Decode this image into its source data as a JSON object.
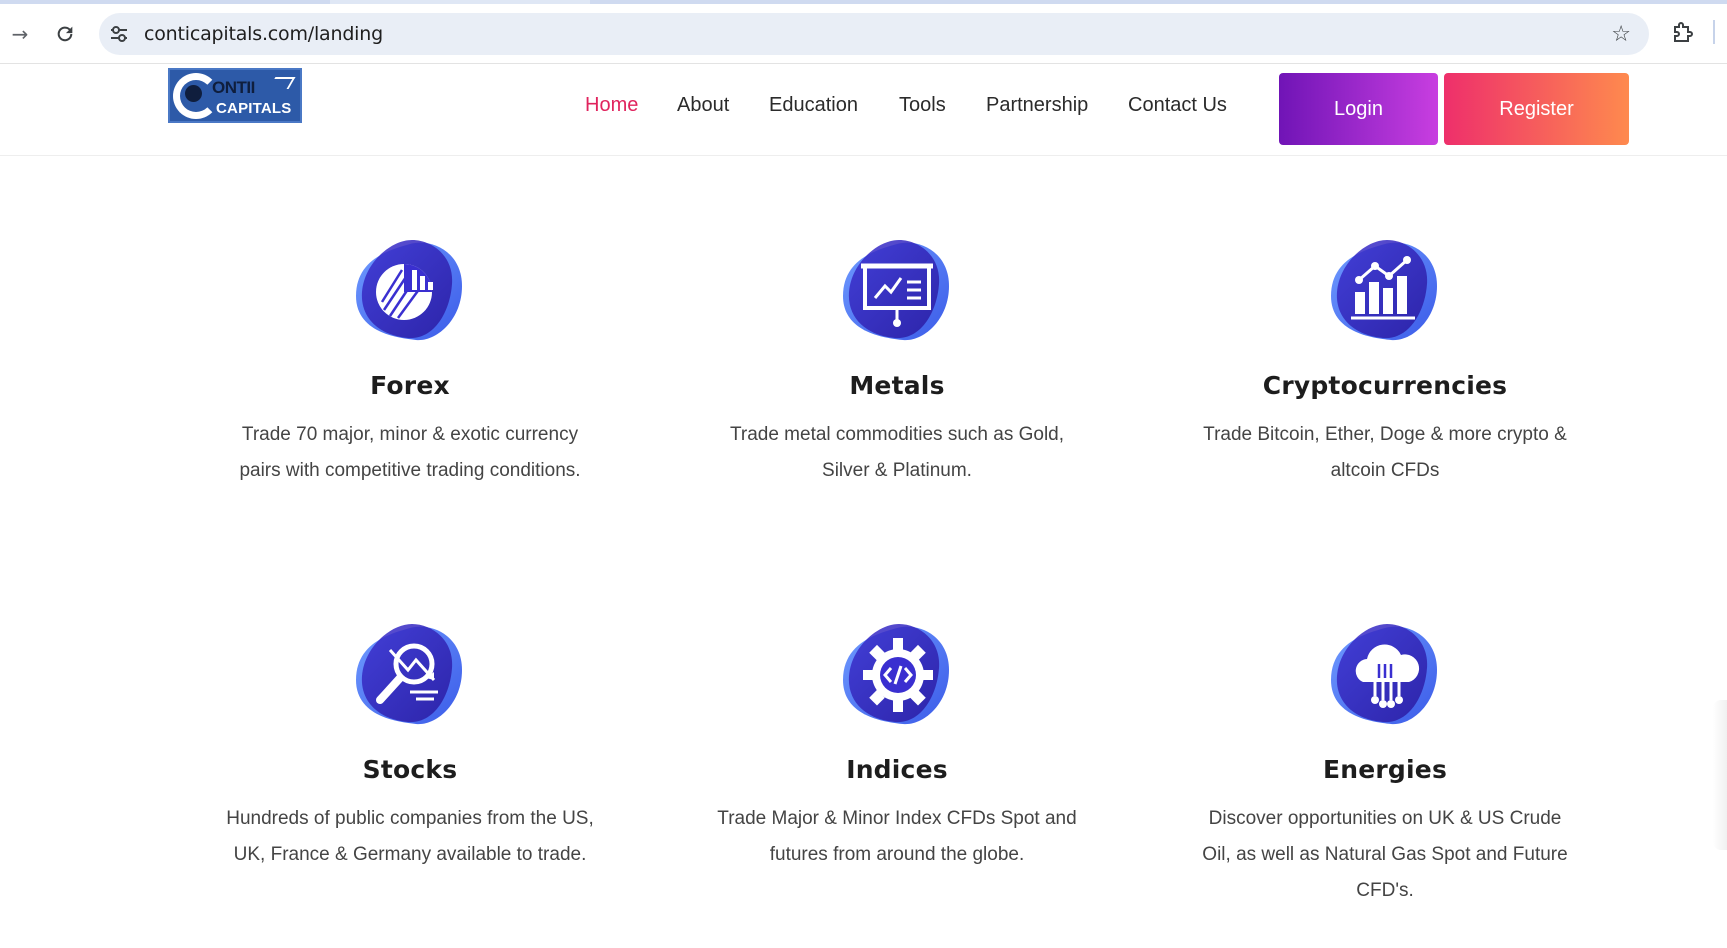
{
  "browser": {
    "url": "conticapitals.com/landing",
    "back_icon": "arrow-right-icon",
    "reload_icon": "reload-icon",
    "site_info_icon": "tune-icon",
    "bookmark_icon": "star-icon",
    "extensions_icon": "puzzle-icon"
  },
  "logo": {
    "line1": "ONTII",
    "line2": "CAPITALS",
    "brand_color": "#2d5aa8"
  },
  "nav": {
    "items": [
      {
        "label": "Home",
        "active": true
      },
      {
        "label": "About",
        "active": false
      },
      {
        "label": "Education",
        "active": false
      },
      {
        "label": "Tools",
        "active": false
      },
      {
        "label": "Partnership",
        "active": false
      },
      {
        "label": "Contact Us",
        "active": false
      }
    ],
    "active_color": "#e0245e",
    "login_label": "Login",
    "register_label": "Register"
  },
  "features": [
    {
      "title": "Forex",
      "description": "Trade 70 major, minor & exotic currency pairs with competitive trading conditions.",
      "icon": "pie-chart-icon"
    },
    {
      "title": "Metals",
      "description": "Trade metal commodities such as Gold, Silver & Platinum.",
      "icon": "presentation-board-icon"
    },
    {
      "title": "Cryptocurrencies",
      "description": "Trade Bitcoin, Ether, Doge & more crypto & altcoin CFDs",
      "icon": "bar-chart-growth-icon"
    },
    {
      "title": "Stocks",
      "description": "Hundreds of public companies from the US, UK, France & Germany available to trade.",
      "icon": "magnifier-trend-icon"
    },
    {
      "title": "Indices",
      "description": "Trade Major & Minor Index CFDs Spot and futures from around the globe.",
      "icon": "code-gear-icon"
    },
    {
      "title": "Energies",
      "description": "Discover opportunities on UK & US Crude Oil, as well as Natural Gas Spot and Future CFD's.",
      "icon": "cloud-network-icon"
    }
  ],
  "colors": {
    "icon_gradient_start": "#5b8cff",
    "icon_gradient_end": "#2a1fb0",
    "login_gradient": [
      "#7014b6",
      "#c83ee0"
    ],
    "register_gradient": [
      "#ee2f6b",
      "#fe8a4e"
    ]
  }
}
